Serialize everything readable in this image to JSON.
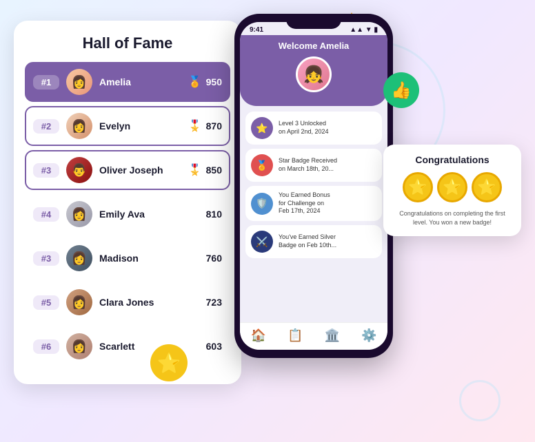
{
  "page": {
    "background": "#f0eaff"
  },
  "hall_of_fame": {
    "title": "Hall of Fame",
    "entries": [
      {
        "rank": "#1",
        "name": "Amelia",
        "score": "950",
        "medal": "🥇",
        "highlight": true,
        "avatar_bg": "avatar-1"
      },
      {
        "rank": "#2",
        "name": "Evelyn",
        "score": "870",
        "medal": "🥈",
        "highlight": false,
        "avatar_bg": "avatar-2"
      },
      {
        "rank": "#3",
        "name": "Oliver Joseph",
        "score": "850",
        "medal": "🥉",
        "highlight": false,
        "avatar_bg": "avatar-3"
      },
      {
        "rank": "#4",
        "name": "Emily Ava",
        "score": "810",
        "medal": "",
        "highlight": false,
        "avatar_bg": "avatar-4"
      },
      {
        "rank": "#3",
        "name": "Madison",
        "score": "760",
        "medal": "",
        "highlight": false,
        "avatar_bg": "avatar-5"
      },
      {
        "rank": "#5",
        "name": "Clara Jones",
        "score": "723",
        "medal": "",
        "highlight": false,
        "avatar_bg": "avatar-6"
      },
      {
        "rank": "#6",
        "name": "Scarlett",
        "score": "603",
        "medal": "",
        "highlight": false,
        "avatar_bg": "avatar-7"
      }
    ]
  },
  "phone": {
    "status_bar": {
      "time": "9:41",
      "signal": "●●● ▼",
      "battery": "▮▮▮"
    },
    "welcome_text": "Welcome Amelia",
    "activities": [
      {
        "text": "Level 3 Unlocked on April 2nd, 2024",
        "icon_color": "ai-purple",
        "icon": "⭐"
      },
      {
        "text": "Star Badge Received on March 18th, 20...",
        "icon_color": "ai-red",
        "icon": "🏅"
      },
      {
        "text": "You Earned Bonus for Challenge on Feb 17th, 2024",
        "icon_color": "ai-blue",
        "icon": "🛡️"
      },
      {
        "text": "You've Earned Silver Badge on Feb 10th...",
        "icon_color": "ai-navy",
        "icon": "⚔️"
      }
    ],
    "nav_items": [
      "🏠",
      "📋",
      "🏛️",
      "⚙️"
    ]
  },
  "congrats": {
    "title": "Congratulations",
    "text": "Congratulations on completing the first level. You won a new badge!",
    "stars": [
      "⭐",
      "⭐",
      "⭐"
    ]
  }
}
